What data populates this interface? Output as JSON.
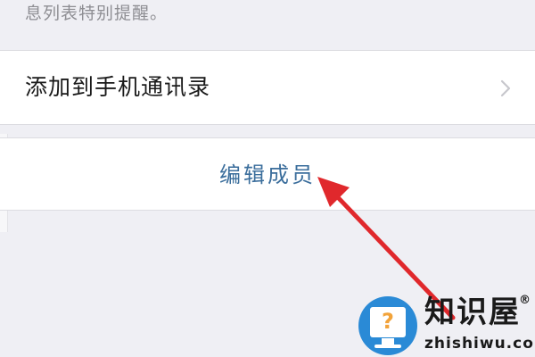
{
  "hint": {
    "text": "息列表特别提醒。"
  },
  "add_contact": {
    "label": "添加到手机通讯录",
    "chevron_icon": "chevron-right-icon"
  },
  "edit_members": {
    "label": "编辑成员"
  },
  "annotation": {
    "arrow_icon": "red-arrow-icon",
    "color": "#e0282c"
  },
  "watermark": {
    "brand": "知识屋",
    "registered": "®",
    "domain": "zhishiwu.com",
    "logo_icon": "question-monitor-icon",
    "colors": {
      "circle": "#2a8ad6",
      "question": "#f2a33a"
    }
  },
  "colors": {
    "background": "#efeff4",
    "cell": "#ffffff",
    "link": "#3b6e9c",
    "secondary_text": "#8e8e93"
  }
}
